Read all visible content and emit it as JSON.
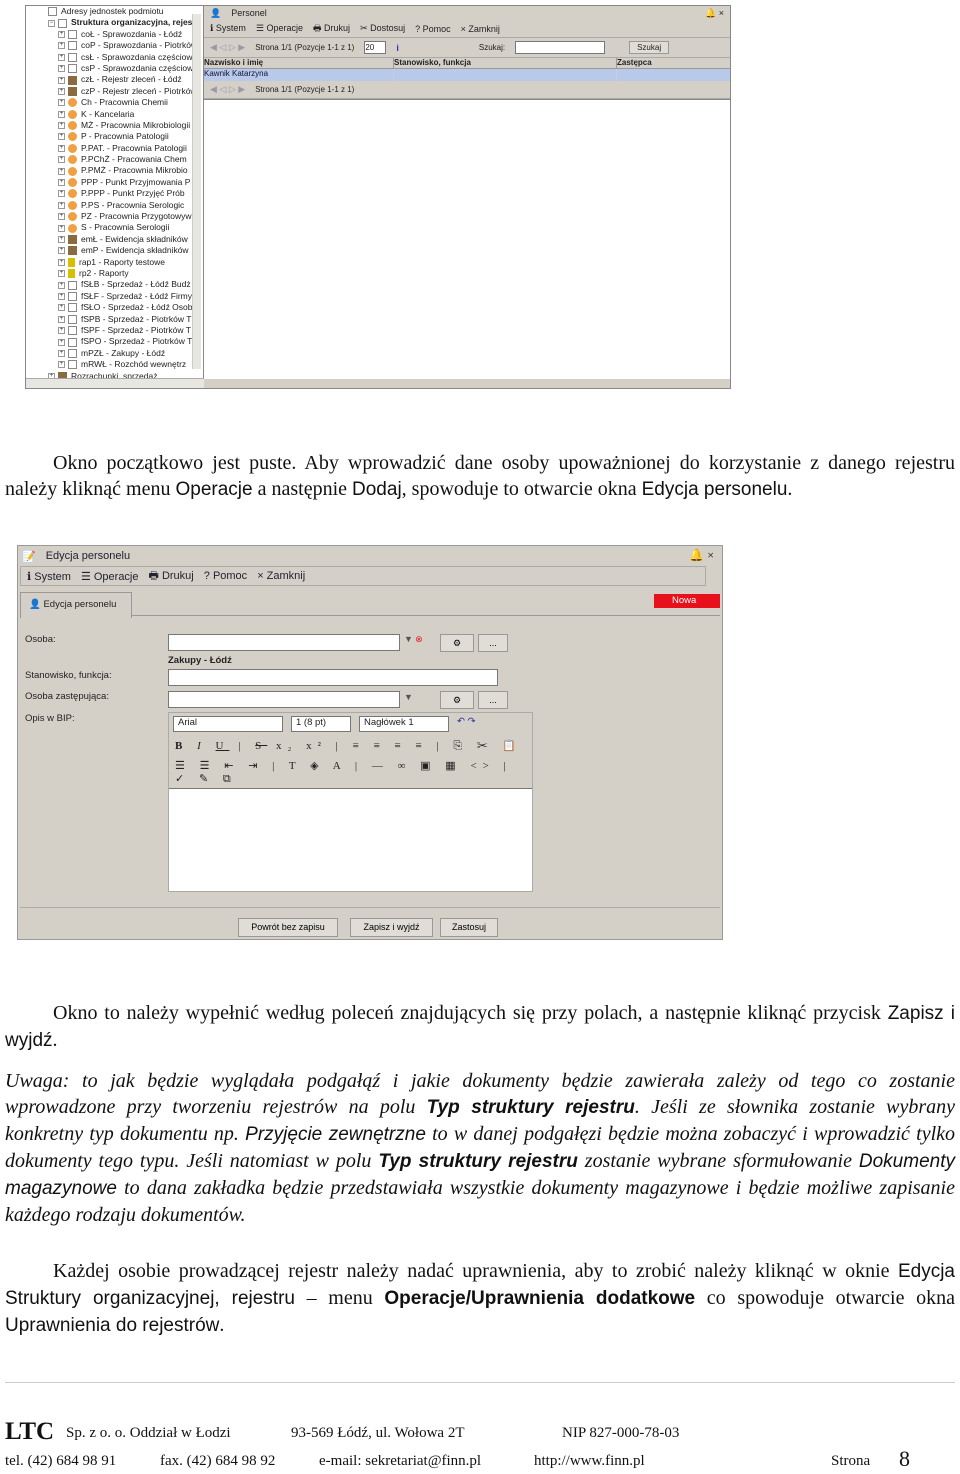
{
  "screenshot1": {
    "tree": [
      {
        "label": "Adresy jednostek podmiotu",
        "icon": "card-icon",
        "level": 0
      },
      {
        "label": "Struktura organizacyjna, rejestr",
        "icon": "org-icon",
        "level": 0,
        "bold": true
      },
      {
        "label": "coŁ - Sprawozdania - Łódź",
        "icon": "doc"
      },
      {
        "label": "coP - Sprawozdania - Piotrków",
        "icon": "doc"
      },
      {
        "label": "csŁ - Sprawozdania częściowe",
        "icon": "doc"
      },
      {
        "label": "csP - Sprawozdania częściowe",
        "icon": "doc"
      },
      {
        "label": "czŁ - Rejestr zleceń - Łódź",
        "icon": "box"
      },
      {
        "label": "czP - Rejestr zleceń - Piotrków",
        "icon": "box"
      },
      {
        "label": "Ch - Pracownia Chemii",
        "icon": "circle"
      },
      {
        "label": "K - Kancelaria",
        "icon": "circle"
      },
      {
        "label": "MŻ - Pracownia Mikrobiologii",
        "icon": "circle"
      },
      {
        "label": "P - Pracownia Patologii",
        "icon": "circle"
      },
      {
        "label": "P.PAT. - Pracownia Patologii",
        "icon": "circle"
      },
      {
        "label": "P.PChŻ - Pracowania Chem",
        "icon": "circle"
      },
      {
        "label": "P.PMŻ - Pracownia Mikrobio",
        "icon": "circle"
      },
      {
        "label": "PPP - Punkt Przyjmowania P",
        "icon": "circle"
      },
      {
        "label": "P.PPP - Punkt Przyjęć Prób",
        "icon": "circle"
      },
      {
        "label": "P.PS - Pracownia Serologic",
        "icon": "circle"
      },
      {
        "label": "PZ - Pracownia Przygotowyw",
        "icon": "circle"
      },
      {
        "label": "S - Pracownia Serologii",
        "icon": "circle"
      },
      {
        "label": "emŁ - Ewidencja składników",
        "icon": "box"
      },
      {
        "label": "emP - Ewidencja składników",
        "icon": "box"
      },
      {
        "label": "rap1 - Raporty testowe",
        "icon": "tt"
      },
      {
        "label": "rp2 - Raporty",
        "icon": "tt"
      },
      {
        "label": "fSŁB - Sprzedaż - Łódź Budż",
        "icon": "doc"
      },
      {
        "label": "fSŁF - Sprzedaż - Łódź Firmy",
        "icon": "doc"
      },
      {
        "label": "fSŁO - Sprzedaż - Łódź Osob",
        "icon": "doc"
      },
      {
        "label": "fSPB - Sprzedaż - Piotrków T",
        "icon": "doc"
      },
      {
        "label": "fSPF - Sprzedaż - Piotrków T",
        "icon": "doc"
      },
      {
        "label": "fSPO - Sprzedaż - Piotrków T",
        "icon": "doc"
      },
      {
        "label": "mPZŁ - Zakupy - Łódź",
        "icon": "doc"
      },
      {
        "label": "mRWŁ - Rozchód wewnętrz",
        "icon": "doc"
      },
      {
        "label": "Rozrachunki, sprzedaż",
        "icon": "box",
        "level": 0
      }
    ],
    "window_title": "Personel",
    "menu": [
      "System",
      "Operacje",
      "Drukuj",
      "Dostosuj",
      "Pomoc",
      "Zamknij"
    ],
    "pager": "Strona 1/1 (Pozycje 1-1 z 1)",
    "page_size": "20",
    "search_label": "Szukaj:",
    "search_value": "",
    "search_button": "Szukaj",
    "columns": [
      "Nazwisko i imię",
      "Stanowisko, funkcja",
      "Zastępca"
    ],
    "rows": [
      [
        "Kawnik Katarzyna",
        "",
        ""
      ]
    ]
  },
  "para1": {
    "a": "Okno początkowo jest puste. Aby wprowadzić dane osoby upoważnionej do korzystanie z danego rejestru należy kliknąć menu ",
    "b": "Operacje",
    "c": " a następnie ",
    "d": "Dodaj",
    "e": ", spowoduje to otwarcie okna ",
    "f": "Edycja personelu",
    "g": "."
  },
  "screenshot2": {
    "window_title": "Edycja personelu",
    "menu": [
      "System",
      "Operacje",
      "Drukuj",
      "Pomoc",
      "Zamknij"
    ],
    "tab": "Edycja personelu",
    "badge": "Nowa",
    "badge_color": "#e8101a",
    "labels": {
      "osoba": "Osoba:",
      "stanowisko": "Stanowisko, funkcja:",
      "zastepca": "Osoba zastępująca:",
      "opis": "Opis w BIP:"
    },
    "register_name": "Zakupy - Łódź",
    "ellipsis": "...",
    "editor": {
      "font": "Arial",
      "size": "1 (8 pt)",
      "style": "Nagłówek 1"
    },
    "buttons": [
      "Powrót bez zapisu",
      "Zapisz i wyjdź",
      "Zastosuj"
    ]
  },
  "para2": {
    "a": "Okno to należy wypełnić według poleceń znajdujących się przy polach, a następnie kliknąć przycisk ",
    "b": "Zapisz i wyjdź",
    "c": "."
  },
  "para3": {
    "a": "Uwaga: to jak będzie wyglądała podgałąź i jakie dokumenty będzie zawierała zależy od tego co zostanie wprowadzone przy tworzeniu rejestrów na polu ",
    "b": "Typ struktury rejestru",
    "c": ". Jeśli ze słownika zostanie wybrany konkretny typ dokumentu np. ",
    "d": "Przyjęcie zewnętrzne",
    "e": " to w danej podgałęzi będzie można zobaczyć i wprowadzić tylko dokumenty tego typu. Jeśli natomiast w polu ",
    "f": "Typ struktury rejestru",
    "g": " zostanie wybrane sformułowanie ",
    "h": "Dokumenty magazynowe",
    "i": " to dana zakładka będzie przedstawiała wszystkie dokumenty magazynowe i będzie możliwe zapisanie każdego rodzaju dokumentów."
  },
  "para4": {
    "a": "Każdej osobie prowadzącej rejestr należy nadać uprawnienia, aby to zrobić należy kliknąć w oknie ",
    "b": "Edycja Struktury organizacyjnej, rejestru",
    "c": " – menu ",
    "d": "Operacje/Uprawnienia dodatkowe",
    "e": " co spowoduje otwarcie okna ",
    "f": "Uprawnienia do rejestrów",
    "g": "."
  },
  "footer": {
    "logo": "LTC",
    "company": "Sp. z o. o. Oddział w Łodzi",
    "address": "93-569 Łódź, ul. Wołowa 2T",
    "nip": "NIP 827-000-78-03",
    "tel": "tel. (42) 684 98 91",
    "fax": "fax. (42) 684 98 92",
    "email": "e-mail:  sekretariat@finn.pl",
    "www": "http://www.finn.pl",
    "page_label": "Strona",
    "page": "8"
  }
}
